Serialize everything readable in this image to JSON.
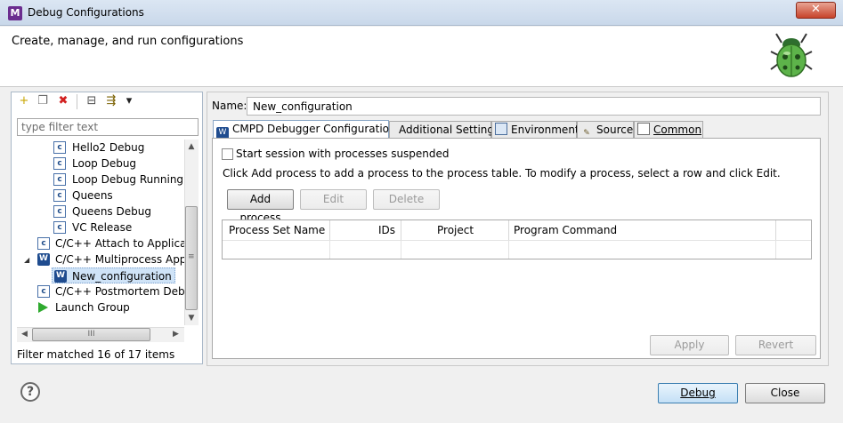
{
  "window": {
    "title": "Debug Configurations",
    "logo": "M",
    "close_glyph": "✕"
  },
  "header": {
    "title": "Create, manage, and run configurations",
    "icon": "bug-icon"
  },
  "left_panel": {
    "toolbar": [
      {
        "name": "new-config-icon",
        "glyph": "+"
      },
      {
        "name": "duplicate-icon",
        "glyph": "❐"
      },
      {
        "name": "delete-icon",
        "glyph": "✖"
      },
      {
        "name": "collapse-all-icon",
        "glyph": "⊟"
      },
      {
        "name": "filter-icon",
        "glyph": "⇶"
      },
      {
        "name": "view-menu-icon",
        "glyph": "▾"
      }
    ],
    "filter_placeholder": "type filter text",
    "tree": [
      {
        "label": "Hello2 Debug",
        "icon": "c-launch-icon",
        "level": 2
      },
      {
        "label": "Loop Debug",
        "icon": "c-launch-icon",
        "level": 2
      },
      {
        "label": "Loop Debug Running",
        "icon": "c-launch-icon",
        "level": 2
      },
      {
        "label": "Queens",
        "icon": "c-launch-icon",
        "level": 2
      },
      {
        "label": "Queens Debug",
        "icon": "c-launch-icon",
        "level": 2
      },
      {
        "label": "VC Release",
        "icon": "c-launch-icon",
        "level": 2
      },
      {
        "label": "C/C++ Attach to Applicatio",
        "icon": "c-attach-icon",
        "level": 1
      },
      {
        "label": "C/C++ Multiprocess Applic",
        "icon": "multiprocess-icon",
        "level": 1,
        "expanded": true
      },
      {
        "label": "New_configuration",
        "icon": "multiprocess-icon",
        "level": 2,
        "selected": true
      },
      {
        "label": "C/C++ Postmortem Debug",
        "icon": "c-postmortem-icon",
        "level": 1
      },
      {
        "label": "Launch Group",
        "icon": "launch-group-icon",
        "level": 1
      }
    ],
    "filter_status": "Filter matched 16 of 17 items",
    "scroll_glyphs": {
      "up": "▲",
      "down": "▼",
      "left": "◀",
      "right": "▶",
      "thumb_grip_h": "III",
      "thumb_grip_v": "≡"
    }
  },
  "right_panel": {
    "name_label": "Name:",
    "name_value": "New_configuration",
    "tabs": [
      {
        "label": "CMPD Debugger Configuration",
        "icon": "multiprocess-icon",
        "active": true
      },
      {
        "label": "Additional Settings",
        "icon": "",
        "active": false
      },
      {
        "label": "Environment",
        "icon": "environment-icon",
        "active": false
      },
      {
        "label": "Source",
        "icon": "source-icon",
        "active": false
      },
      {
        "label": "Common",
        "icon": "common-icon",
        "active": false
      }
    ],
    "suspend_label": "Start session with processes suspended",
    "suspend_checked": false,
    "help_text": "Click Add process to add a process to the process table. To modify a process, select a row and click Edit.",
    "buttons": {
      "add_process": "Add process",
      "edit": "Edit",
      "delete": "Delete"
    },
    "table_columns": [
      "Process Set Name",
      "IDs",
      "Project",
      "Program Command"
    ],
    "table_rows": [],
    "apply_label": "Apply",
    "revert_label": "Revert"
  },
  "footer": {
    "help_glyph": "?",
    "debug_label": "Debug",
    "close_label": "Close"
  }
}
